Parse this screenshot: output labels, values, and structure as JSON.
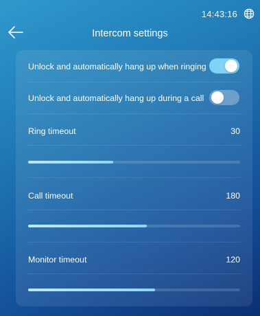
{
  "status": {
    "time": "14:43:16",
    "icon": "globe-icon"
  },
  "header": {
    "back_icon": "back-arrow-icon",
    "title": "Intercom settings"
  },
  "toggles": [
    {
      "label": "Unlock and automatically hang up when ringing",
      "state": "on"
    },
    {
      "label": "Unlock and automatically hang up during a call",
      "state": "off"
    }
  ],
  "timeouts": [
    {
      "label": "Ring timeout",
      "value": "30",
      "fill_fraction": 0.4
    },
    {
      "label": "Call timeout",
      "value": "180",
      "fill_fraction": 0.56
    },
    {
      "label": "Monitor timeout",
      "value": "120",
      "fill_fraction": 0.6
    }
  ],
  "colors": {
    "toggle_on": "#7fd3f6",
    "slider_fill": "#9fdcfb"
  }
}
